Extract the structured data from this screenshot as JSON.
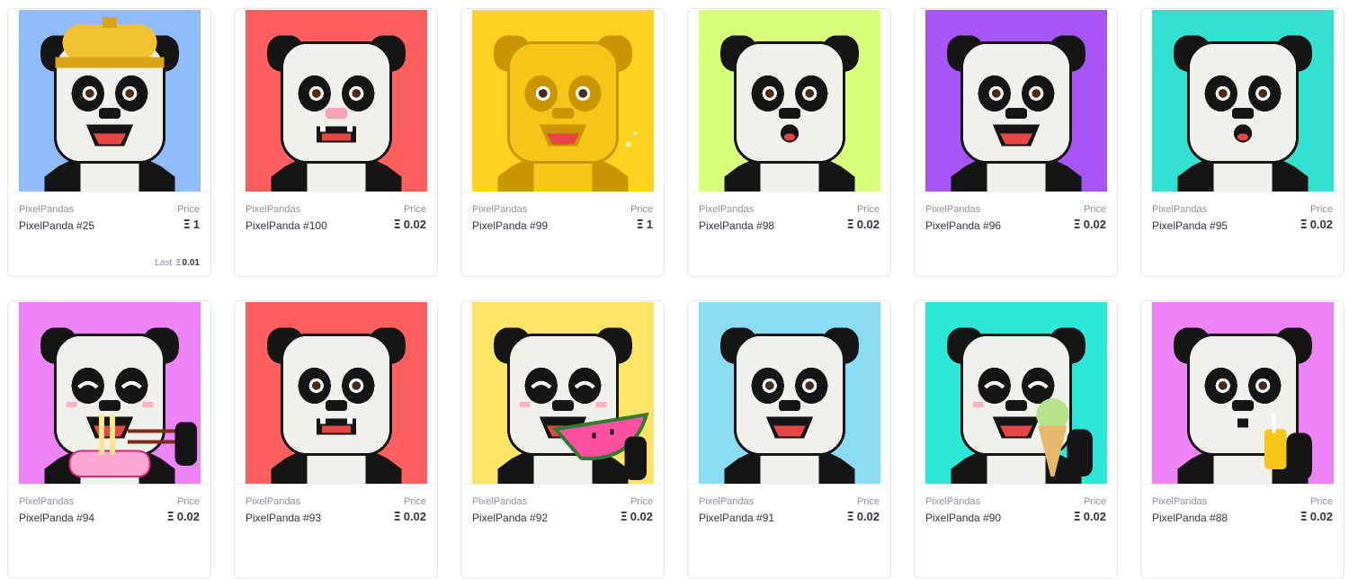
{
  "labels": {
    "price": "Price",
    "last": "Last",
    "eth_symbol": "Ξ"
  },
  "colors": {
    "pandaBlack": "#151515",
    "pandaWhite": "#f2f0ea",
    "mouth": "#e84545"
  },
  "items": [
    {
      "collection": "PixelPandas",
      "name": "PixelPanda #25",
      "price": "1",
      "last": "0.01",
      "bg": "#8fbcff",
      "accessory": "hard-hat",
      "expression": "smile",
      "brand_icon": "panda-nft-image-icon"
    },
    {
      "collection": "PixelPandas",
      "name": "PixelPanda #100",
      "price": "0.02",
      "bg": "#ff5f5f",
      "accessory": "pink-nose",
      "expression": "fangs"
    },
    {
      "collection": "PixelPandas",
      "name": "PixelPanda #99",
      "price": "1",
      "bg": "#ffd21f",
      "accessory": "gold-panda",
      "expression": "smile"
    },
    {
      "collection": "PixelPandas",
      "name": "PixelPanda #98",
      "price": "0.02",
      "bg": "#d7ff7a",
      "accessory": "none",
      "expression": "surprised"
    },
    {
      "collection": "PixelPandas",
      "name": "PixelPanda #96",
      "price": "0.02",
      "bg": "#a855f7",
      "accessory": "none",
      "expression": "smile"
    },
    {
      "collection": "PixelPandas",
      "name": "PixelPanda #95",
      "price": "0.02",
      "bg": "#34e0cf",
      "accessory": "none",
      "expression": "surprised"
    },
    {
      "collection": "PixelPandas",
      "name": "PixelPanda #94",
      "price": "0.02",
      "bg": "#ee82f7",
      "accessory": "noodles",
      "expression": "happy"
    },
    {
      "collection": "PixelPandas",
      "name": "PixelPanda #93",
      "price": "0.02",
      "bg": "#ff5f5f",
      "accessory": "none",
      "expression": "fangs"
    },
    {
      "collection": "PixelPandas",
      "name": "PixelPanda #92",
      "price": "0.02",
      "bg": "#ffe566",
      "accessory": "watermelon",
      "expression": "happy"
    },
    {
      "collection": "PixelPandas",
      "name": "PixelPanda #91",
      "price": "0.02",
      "bg": "#8adcf5",
      "accessory": "none",
      "expression": "smile"
    },
    {
      "collection": "PixelPandas",
      "name": "PixelPanda #90",
      "price": "0.02",
      "bg": "#2ce8d6",
      "accessory": "ice-cream",
      "expression": "happy"
    },
    {
      "collection": "PixelPandas",
      "name": "PixelPanda #88",
      "price": "0.02",
      "bg": "#ee82f7",
      "accessory": "juice",
      "expression": "sip"
    }
  ]
}
